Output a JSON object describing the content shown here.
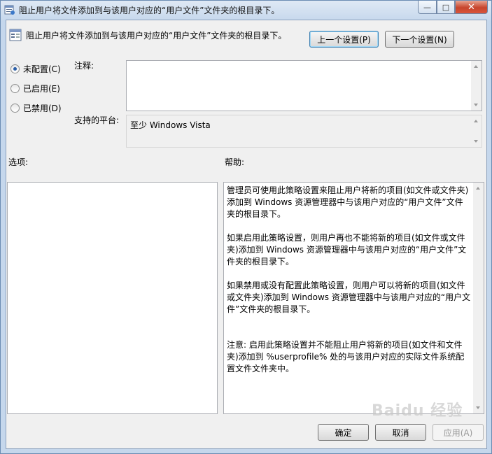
{
  "window": {
    "title": "阻止用户将文件添加到与该用户对应的“用户文件”文件夹的根目录下。",
    "controls": [
      "minimize",
      "maximize",
      "close"
    ]
  },
  "header": {
    "setting_name": "阻止用户将文件添加到与该用户对应的“用户文件”文件夹的根目录下。",
    "prev_button": "上一个设置(P)",
    "next_button": "下一个设置(N)"
  },
  "state_options": [
    {
      "label": "未配置(C)",
      "checked": true
    },
    {
      "label": "已启用(E)",
      "checked": false
    },
    {
      "label": "已禁用(D)",
      "checked": false
    }
  ],
  "comment": {
    "label": "注释:",
    "value": ""
  },
  "platform": {
    "label": "支持的平台:",
    "value": "至少 Windows Vista"
  },
  "options": {
    "label": "选项:"
  },
  "help": {
    "label": "帮助:",
    "text": "管理员可使用此策略设置来阻止用户将新的项目(如文件或文件夹)添加到 Windows 资源管理器中与该用户对应的“用户文件”文件夹的根目录下。\n\n如果启用此策略设置，则用户再也不能将新的项目(如文件或文件夹)添加到 Windows 资源管理器中与该用户对应的“用户文件”文件夹的根目录下。\n\n如果禁用或没有配置此策略设置，则用户可以将新的项目(如文件或文件夹)添加到 Windows 资源管理器中与该用户对应的“用户文件”文件夹的根目录下。\n\n\n注意: 启用此策略设置并不能阻止用户将新的项目(如文件和文件夹)添加到 %userprofile% 处的与该用户对应的实际文件系统配置文件文件夹中。"
  },
  "footer": {
    "ok_button": "确定",
    "cancel_button": "取消",
    "apply_button": "应用(A)"
  },
  "watermark": "Baidu 经验"
}
